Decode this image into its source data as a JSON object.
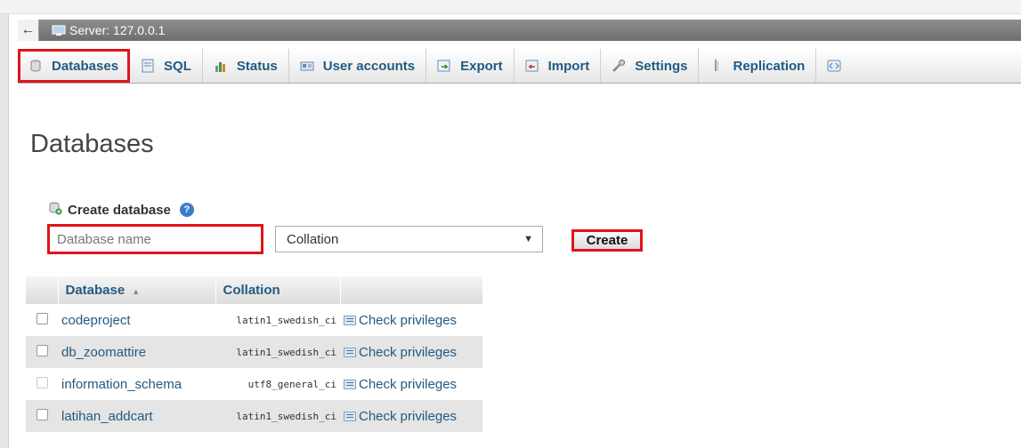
{
  "server": {
    "collapse_label": "←",
    "label": "Server: 127.0.0.1"
  },
  "tabs": [
    {
      "label": "Databases",
      "icon": "database-icon",
      "active": true
    },
    {
      "label": "SQL",
      "icon": "sql-icon"
    },
    {
      "label": "Status",
      "icon": "status-icon"
    },
    {
      "label": "User accounts",
      "icon": "user-accounts-icon"
    },
    {
      "label": "Export",
      "icon": "export-icon"
    },
    {
      "label": "Import",
      "icon": "import-icon"
    },
    {
      "label": "Settings",
      "icon": "settings-wrench-icon"
    },
    {
      "label": "Replication",
      "icon": "replication-icon"
    }
  ],
  "page": {
    "title": "Databases"
  },
  "create": {
    "label": "Create database",
    "name_placeholder": "Database name",
    "collation_value": "Collation",
    "button_label": "Create"
  },
  "table": {
    "headers": [
      "Database",
      "Collation"
    ],
    "rows": [
      {
        "name": "codeproject",
        "collation": "latin1_swedish_ci",
        "action": "Check privileges"
      },
      {
        "name": "db_zoomattire",
        "collation": "latin1_swedish_ci",
        "action": "Check privileges"
      },
      {
        "name": "information_schema",
        "collation": "utf8_general_ci",
        "action": "Check privileges"
      },
      {
        "name": "latihan_addcart",
        "collation": "latin1_swedish_ci",
        "action": "Check privileges"
      }
    ]
  },
  "colors": {
    "link": "#235a81",
    "highlight": "#e0141e"
  }
}
